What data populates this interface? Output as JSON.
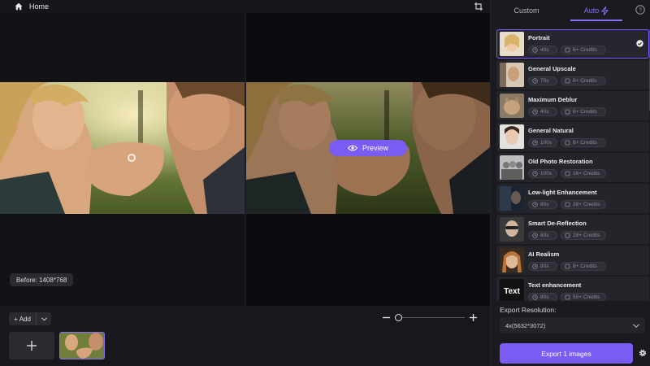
{
  "topbar": {
    "home_label": "Home"
  },
  "canvas": {
    "preview_label": "Preview",
    "before_badge": "Before: 1408*768"
  },
  "bottom": {
    "add_label": "Add"
  },
  "panel": {
    "tabs": [
      {
        "label": "Custom",
        "active": false
      },
      {
        "label": "Auto",
        "active": true
      }
    ],
    "models": [
      {
        "name": "Portrait",
        "time": "40s",
        "credits": "6+ Credits",
        "selected": true
      },
      {
        "name": "General Upscale",
        "time": "70s",
        "credits": "6+ Credits",
        "selected": false
      },
      {
        "name": "Maximum Deblur",
        "time": "40s",
        "credits": "6+ Credits",
        "selected": false
      },
      {
        "name": "General Natural",
        "time": "100s",
        "credits": "6+ Credits",
        "selected": false
      },
      {
        "name": "Old Photo Restoration",
        "time": "100s",
        "credits": "16+ Credits",
        "selected": false
      },
      {
        "name": "Low-light Enhancement",
        "time": "80s",
        "credits": "28+ Credits",
        "selected": false
      },
      {
        "name": "Smart De-Reflection",
        "time": "80s",
        "credits": "28+ Credits",
        "selected": false
      },
      {
        "name": "AI Realism",
        "time": "80s",
        "credits": "8+ Credits",
        "selected": false
      },
      {
        "name": "Text enhancement",
        "time": "80s",
        "credits": "50+ Credits",
        "selected": false
      }
    ],
    "text_thumb_label": "Text",
    "export_resolution_label": "Export Resolution:",
    "export_resolution_value": "4x(5632*3072)",
    "export_button": "Export 1 images"
  },
  "colors": {
    "accent": "#7a5cf2",
    "background": "#0f0f14",
    "panel": "#1a1a20"
  }
}
